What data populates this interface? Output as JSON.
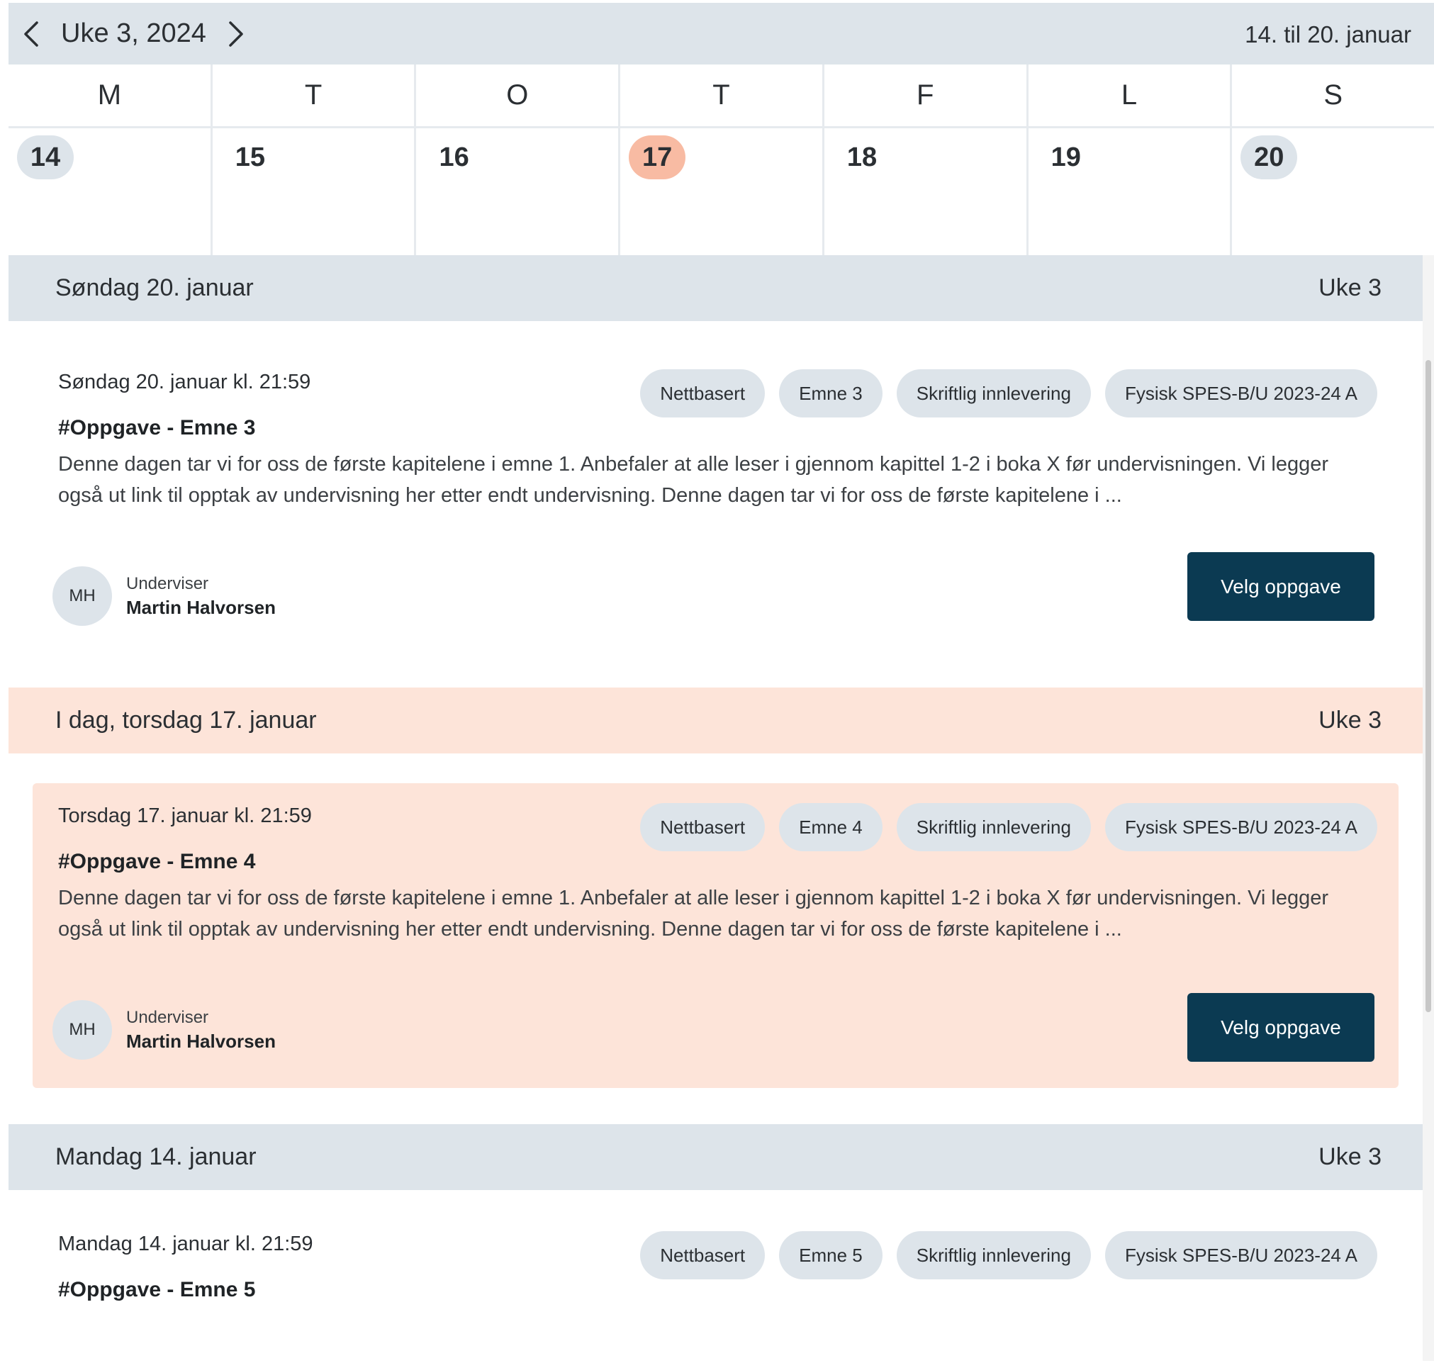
{
  "week": {
    "title": "Uke 3, 2024",
    "range": "14. til 20. januar",
    "prev_icon": "chevron-left-icon",
    "next_icon": "chevron-right-icon"
  },
  "weekdays": [
    "M",
    "T",
    "O",
    "T",
    "F",
    "L",
    "S"
  ],
  "dates": [
    "14",
    "15",
    "16",
    "17",
    "18",
    "19",
    "20"
  ],
  "today_date": "17",
  "colors": {
    "header_bg": "#dde4ea",
    "today_accent": "#f8bba3",
    "today_bg": "#fde4d9",
    "primary_button": "#0b3a52"
  },
  "sections": [
    {
      "header": "Søndag 20. januar",
      "week_label": "Uke 3",
      "card": {
        "date": "Søndag 20. januar kl. 21:59",
        "title": "#Oppgave - Emne 3",
        "description": "Denne dagen tar vi for oss de første kapitelene i emne 1. Anbefaler at alle leser i gjennom kapittel 1-2 i boka X før undervisningen. Vi legger også ut link til opptak av undervisning her etter endt undervisning.  Denne dagen tar vi for oss de første kapitelene i ...",
        "tags": [
          "Nettbasert",
          "Emne 3",
          "Skriftlig innlevering",
          "Fysisk  SPES-B/U 2023-24 A"
        ],
        "avatar": "MH",
        "teacher_role": "Underviser",
        "teacher_name": "Martin Halvorsen",
        "button": "Velg oppgave"
      }
    },
    {
      "header": "I dag, torsdag 17. januar",
      "week_label": "Uke 3",
      "card": {
        "date": "Torsdag 17. januar kl. 21:59",
        "title": "#Oppgave - Emne 4",
        "description": "Denne dagen tar vi for oss de første kapitelene i emne 1. Anbefaler at alle leser i gjennom kapittel 1-2 i boka X før undervisningen. Vi legger også ut link til opptak av undervisning her etter endt undervisning.  Denne dagen tar vi for oss de første kapitelene i ...",
        "tags": [
          "Nettbasert",
          "Emne 4",
          "Skriftlig innlevering",
          "Fysisk  SPES-B/U 2023-24 A"
        ],
        "avatar": "MH",
        "teacher_role": "Underviser",
        "teacher_name": "Martin Halvorsen",
        "button": "Velg oppgave"
      }
    },
    {
      "header": "Mandag 14. januar",
      "week_label": "Uke 3",
      "card": {
        "date": "Mandag 14. januar kl. 21:59",
        "title": "#Oppgave - Emne 5",
        "tags": [
          "Nettbasert",
          "Emne 5",
          "Skriftlig innlevering",
          "Fysisk  SPES-B/U 2023-24 A"
        ]
      }
    }
  ]
}
